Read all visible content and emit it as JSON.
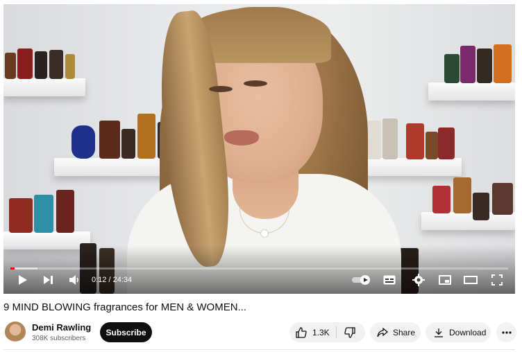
{
  "video": {
    "title": "9 MIND BLOWING fragrances for MEN & WOMEN...",
    "current_time": "0:12",
    "duration": "24:34",
    "time_display": "0:12 / 24:34",
    "progress_played_fraction": 0.0081,
    "progress_buffered_fraction": 0.055,
    "accent_color": "#ff0000"
  },
  "controls": {
    "play_icon": "play-icon",
    "next_icon": "skip-next-icon",
    "volume_icon": "volume-icon",
    "autoplay_icon": "autoplay-toggle-icon",
    "captions_icon": "subtitles-icon",
    "settings_icon": "gear-icon",
    "miniplayer_icon": "miniplayer-icon",
    "theater_icon": "theater-mode-icon",
    "fullscreen_icon": "fullscreen-icon"
  },
  "channel": {
    "name": "Demi Rawling",
    "subscribers": "308K subscribers",
    "subscribe_label": "Subscribe"
  },
  "actions": {
    "like_count": "1.3K",
    "share_label": "Share",
    "download_label": "Download",
    "more_icon": "more-horizontal-icon"
  }
}
